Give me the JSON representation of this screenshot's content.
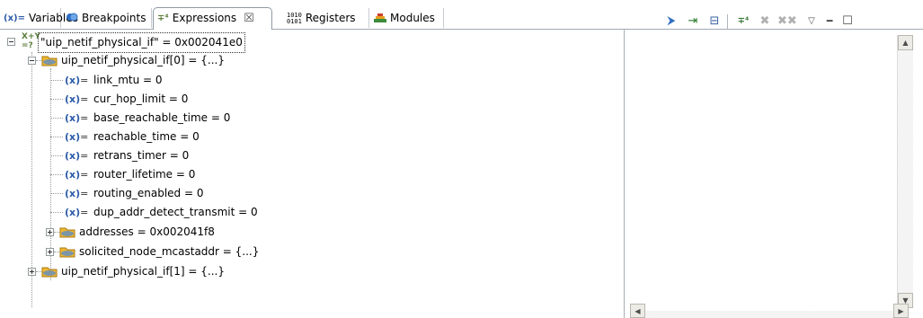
{
  "tabs": [
    {
      "label": "Variables",
      "icon": "variables-icon"
    },
    {
      "label": "Breakpoints",
      "icon": "breakpoints-icon"
    },
    {
      "label": "Expressions",
      "icon": "expressions-icon",
      "active": true
    },
    {
      "label": "Registers",
      "icon": "registers-icon"
    },
    {
      "label": "Modules",
      "icon": "modules-icon"
    }
  ],
  "toolbar": [
    "show-type-names-icon",
    "collapse-all-icon",
    "layout-icon",
    "add-watch-expression-icon",
    "remove-expression-icon",
    "remove-all-expressions-icon",
    "view-menu-icon",
    "minimize-icon",
    "maximize-icon"
  ],
  "tree": {
    "root": "\"uip_netif_physical_if\" = 0x002041e0",
    "child0": "uip_netif_physical_if[0] = {...}",
    "fields": [
      "link_mtu = 0",
      "cur_hop_limit = 0",
      "base_reachable_time = 0",
      "reachable_time = 0",
      "retrans_timer = 0",
      "router_lifetime = 0",
      "routing_enabled = 0",
      "dup_addr_detect_transmit = 0"
    ],
    "addresses": "addresses = 0x002041f8",
    "solicited": "solicited_node_mcastaddr = {...}",
    "child1": "uip_netif_physical_if[1] = {...}"
  },
  "colors": {
    "accent": "#2a5aa8",
    "folder": "#f0b830"
  }
}
